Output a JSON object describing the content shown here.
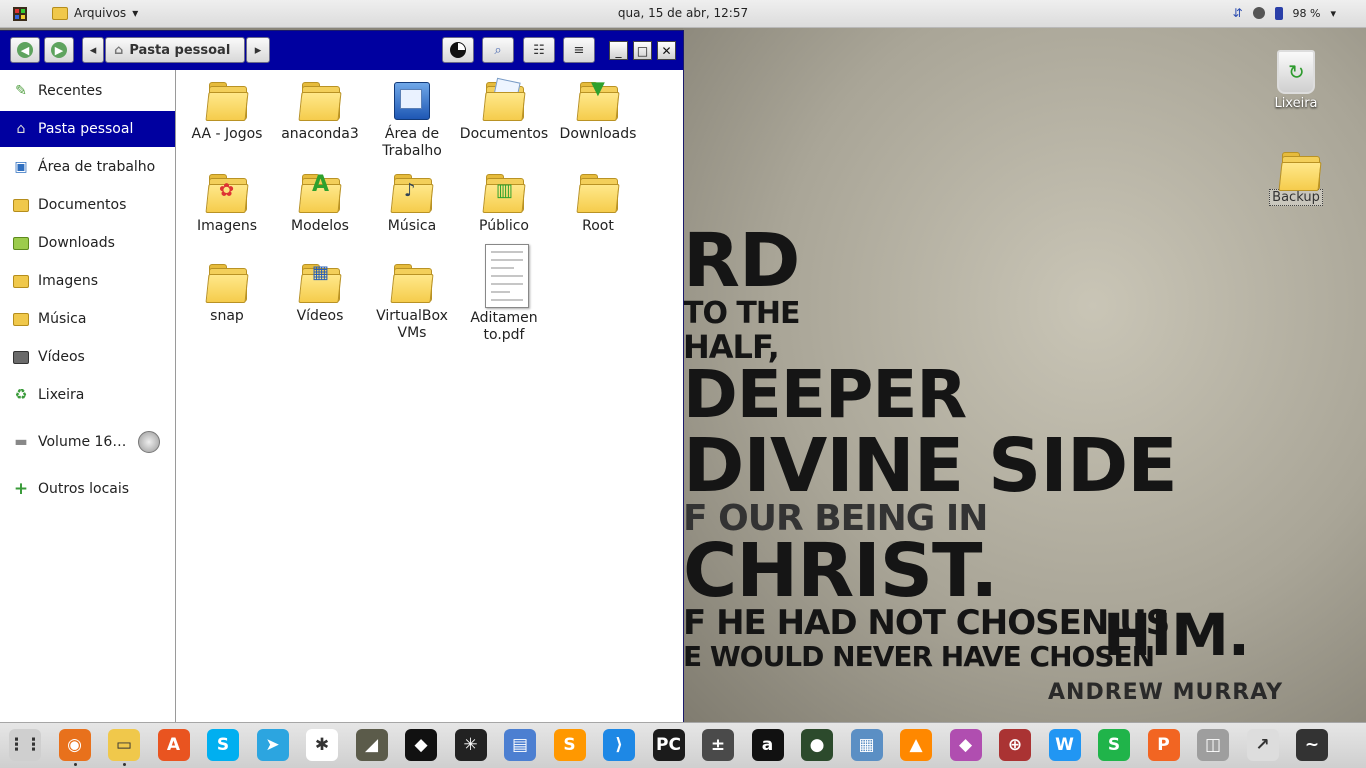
{
  "top_panel": {
    "app_menu_label": "Arquivos",
    "clock": "qua, 15 de abr, 12:57",
    "battery_label": "98 %"
  },
  "window": {
    "location_label": "Pasta pessoal"
  },
  "sidebar": {
    "items": [
      {
        "label": "Recentes",
        "icon": "clock-icon"
      },
      {
        "label": "Pasta pessoal",
        "icon": "home-icon"
      },
      {
        "label": "Área de trabalho",
        "icon": "desktop-icon"
      },
      {
        "label": "Documentos",
        "icon": "documents-icon"
      },
      {
        "label": "Downloads",
        "icon": "downloads-icon"
      },
      {
        "label": "Imagens",
        "icon": "pictures-icon"
      },
      {
        "label": "Música",
        "icon": "music-icon"
      },
      {
        "label": "Vídeos",
        "icon": "videos-icon"
      },
      {
        "label": "Lixeira",
        "icon": "trash-icon"
      },
      {
        "label": "Volume 16…",
        "icon": "drive-icon"
      },
      {
        "label": "Outros locais",
        "icon": "plus-icon"
      }
    ],
    "active_index": 1
  },
  "files": [
    {
      "name": "AA - Jogos",
      "type": "folder"
    },
    {
      "name": "anaconda3",
      "type": "folder"
    },
    {
      "name": "Área de Trabalho",
      "type": "desktop-folder"
    },
    {
      "name": "Documentos",
      "type": "folder"
    },
    {
      "name": "Downloads",
      "type": "folder"
    },
    {
      "name": "Imagens",
      "type": "folder"
    },
    {
      "name": "Modelos",
      "type": "folder"
    },
    {
      "name": "Música",
      "type": "folder"
    },
    {
      "name": "Público",
      "type": "folder"
    },
    {
      "name": "Root",
      "type": "folder"
    },
    {
      "name": "snap",
      "type": "folder"
    },
    {
      "name": "Vídeos",
      "type": "folder"
    },
    {
      "name": "VirtualBox VMs",
      "type": "folder"
    },
    {
      "name": "Aditamento.pdf",
      "type": "pdf"
    }
  ],
  "desktop": {
    "icons": [
      {
        "label": "Lixeira"
      },
      {
        "label": "Backup"
      }
    ],
    "wallpaper_lines": [
      "RD",
      "TO THE",
      "HALF,",
      "DEEPER",
      "DIVINE SIDE",
      "F OUR BEING IN",
      "CHRIST.",
      "F HE HAD NOT CHOSEN US",
      "HIM.",
      "E WOULD NEVER HAVE CHOSEN"
    ],
    "wallpaper_author": "ANDREW MURRAY"
  },
  "dock": {
    "apps": [
      "Mostrar aplicativos",
      "Firefox",
      "Arquivos",
      "Ubuntu Software",
      "Skype",
      "Telegram",
      "Slack",
      "GIMP",
      "Inkscape",
      "Bug",
      "Editor",
      "Sublime Text",
      "VS Code",
      "PyCharm",
      "Calculadora",
      "Anki",
      "Navegador",
      "Imagens",
      "VLC",
      "Pacotes",
      "Pesquisa",
      "WPS Writer",
      "WPS Spreadsheets",
      "WPS Presentation",
      "Gravador",
      "Monitor",
      "Monitor do Sistema"
    ],
    "colors": [
      "#cfcfcf",
      "#e8711c",
      "#f0c84b",
      "#e95420",
      "#00aff0",
      "#2ca5e0",
      "#ffffff",
      "#5b5b4a",
      "#111111",
      "#222222",
      "#4c7fd1",
      "#ff9800",
      "#1e88e5",
      "#1b1b1b",
      "#4a4a4a",
      "#111111",
      "#2c4a2c",
      "#5b8fc4",
      "#ff8800",
      "#b04eb0",
      "#aa3333",
      "#2196f3",
      "#20b44a",
      "#f26522",
      "#9e9e9e",
      "#dddddd",
      "#333333"
    ]
  }
}
